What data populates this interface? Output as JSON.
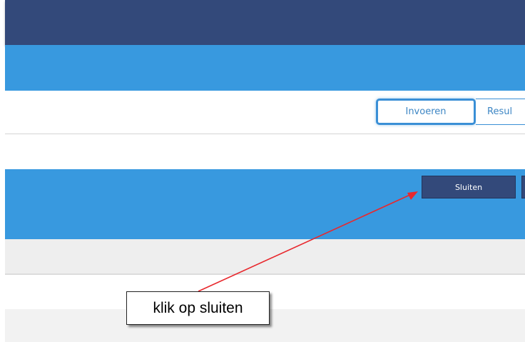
{
  "tabs": {
    "invoeren": "Invoeren",
    "resultaten": "Resul"
  },
  "panel": {
    "close_label": "Sluiten"
  },
  "annotation": {
    "text": "klik op sluiten"
  },
  "colors": {
    "navy": "#33497a",
    "blue": "#3899df",
    "annotation_arrow": "#e8282d"
  }
}
